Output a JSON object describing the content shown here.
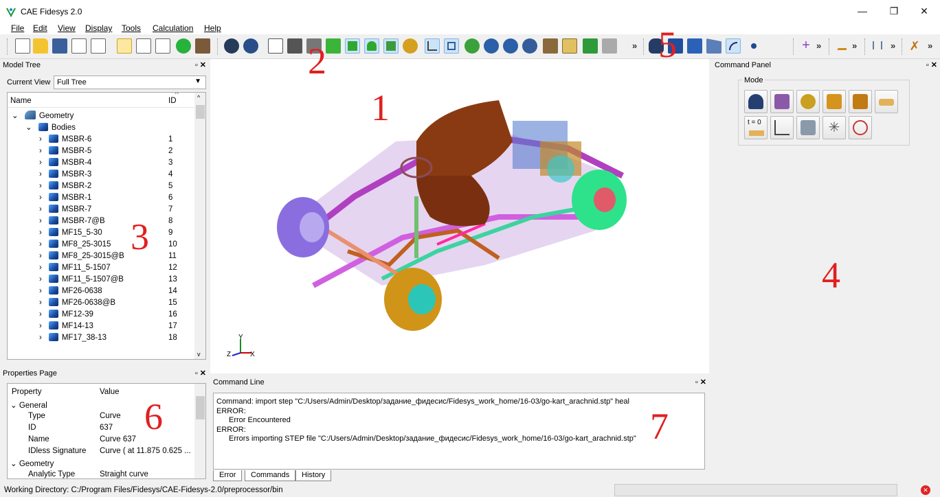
{
  "window": {
    "title": "CAE Fidesys 2.0",
    "min_glyph": "—",
    "max_glyph": "❐",
    "close_glyph": "✕"
  },
  "menu": [
    "File",
    "Edit",
    "View",
    "Display",
    "Tools",
    "Calculation",
    "Help"
  ],
  "toolbar": {
    "overflow_glyph": "»"
  },
  "model_tree": {
    "title": "Model Tree",
    "current_view_label": "Current View",
    "current_view_value": "Full Tree",
    "col_name": "Name",
    "col_id": "ID",
    "geometry_label": "Geometry",
    "bodies_label": "Bodies",
    "rows": [
      {
        "name": "MSBR-6",
        "id": "1"
      },
      {
        "name": "MSBR-5",
        "id": "2"
      },
      {
        "name": "MSBR-4",
        "id": "3"
      },
      {
        "name": "MSBR-3",
        "id": "4"
      },
      {
        "name": "MSBR-2",
        "id": "5"
      },
      {
        "name": "MSBR-1",
        "id": "6"
      },
      {
        "name": "MSBR-7",
        "id": "7"
      },
      {
        "name": "MSBR-7@B",
        "id": "8"
      },
      {
        "name": "MF15_5-30",
        "id": "9"
      },
      {
        "name": "MF8_25-3015",
        "id": "10"
      },
      {
        "name": "MF8_25-3015@B",
        "id": "11"
      },
      {
        "name": "MF11_5-1507",
        "id": "12"
      },
      {
        "name": "MF11_5-1507@B",
        "id": "13"
      },
      {
        "name": "MF26-0638",
        "id": "14"
      },
      {
        "name": "MF26-0638@B",
        "id": "15"
      },
      {
        "name": "MF12-39",
        "id": "16"
      },
      {
        "name": "MF14-13",
        "id": "17"
      },
      {
        "name": "MF17_38-13",
        "id": "18"
      }
    ]
  },
  "properties": {
    "title": "Properties Page",
    "col_property": "Property",
    "col_value": "Value",
    "general_label": "General",
    "rows": [
      {
        "key": "Type",
        "value": "Curve"
      },
      {
        "key": "ID",
        "value": "637"
      },
      {
        "key": "Name",
        "value": "Curve 637"
      },
      {
        "key": "IDless Signature",
        "value": "Curve ( at 11.875 0.625 ..."
      }
    ],
    "geometry_label": "Geometry",
    "analytic_key": "Analytic Type",
    "analytic_value": "Straight curve"
  },
  "command_panel": {
    "title": "Command Panel",
    "mode_label": "Mode",
    "t0_label": "t = 0"
  },
  "command_line": {
    "title": "Command Line",
    "lines": [
      "Command: import step \"C:/Users/Admin/Desktop/задание_фидесис/Fidesys_work_home/16-03/go-kart_arachnid.stp\" heal",
      "ERROR:",
      "Error Encountered",
      "ERROR:",
      "Errors importing STEP file \"C:/Users/Admin/Desktop/задание_фидесис/Fidesys_work_home/16-03/go-kart_arachnid.stp\""
    ],
    "tabs": [
      "Error",
      "Commands",
      "History"
    ]
  },
  "status_bar": {
    "working_dir": "Working Directory: C:/Program Files/Fidesys/CAE-Fidesys-2.0/preprocessor/bin"
  },
  "annotations": [
    "1",
    "2",
    "3",
    "4",
    "5",
    "6",
    "7"
  ],
  "axes": {
    "x": "X",
    "y": "Y",
    "z": "Z"
  },
  "colors": {
    "annotation": "#e02020",
    "selected_tool": "#cce4f7"
  }
}
